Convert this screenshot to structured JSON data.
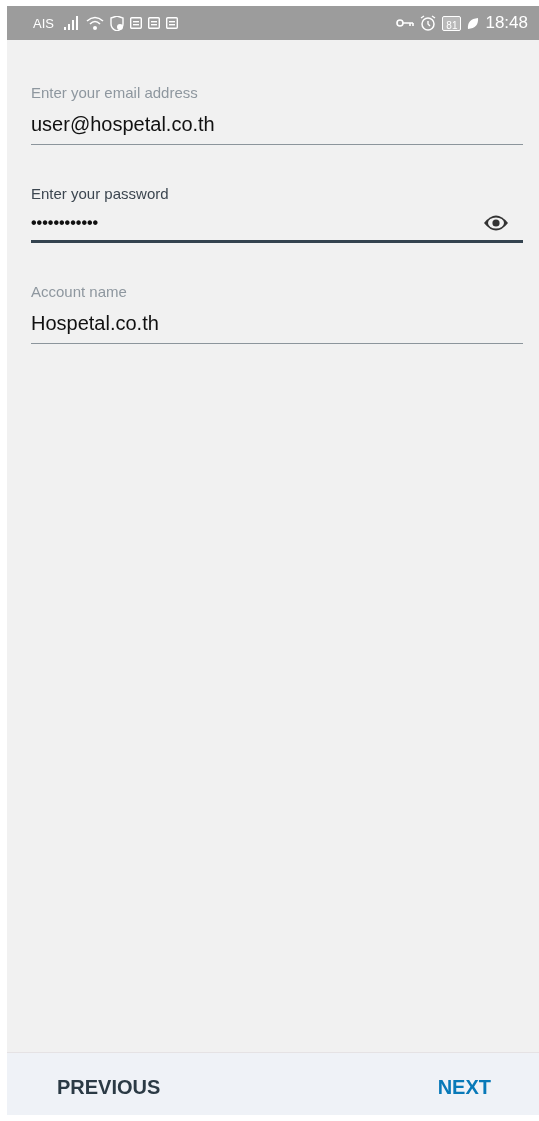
{
  "status_bar": {
    "carrier": "AIS",
    "battery": "81",
    "time": "18:48"
  },
  "fields": [
    {
      "kind": "text",
      "label": "Enter your email address",
      "value": "user@hospetal.co.th",
      "focused": false
    },
    {
      "kind": "password",
      "label": "Enter your password",
      "value": "••••••••••••",
      "focused": true
    },
    {
      "kind": "text",
      "label": "Account name",
      "value": "Hospetal.co.th",
      "focused": false
    }
  ],
  "buttons": [
    {
      "kind": "secondary",
      "label": "PREVIOUS"
    },
    {
      "kind": "primary",
      "label": "NEXT"
    }
  ]
}
